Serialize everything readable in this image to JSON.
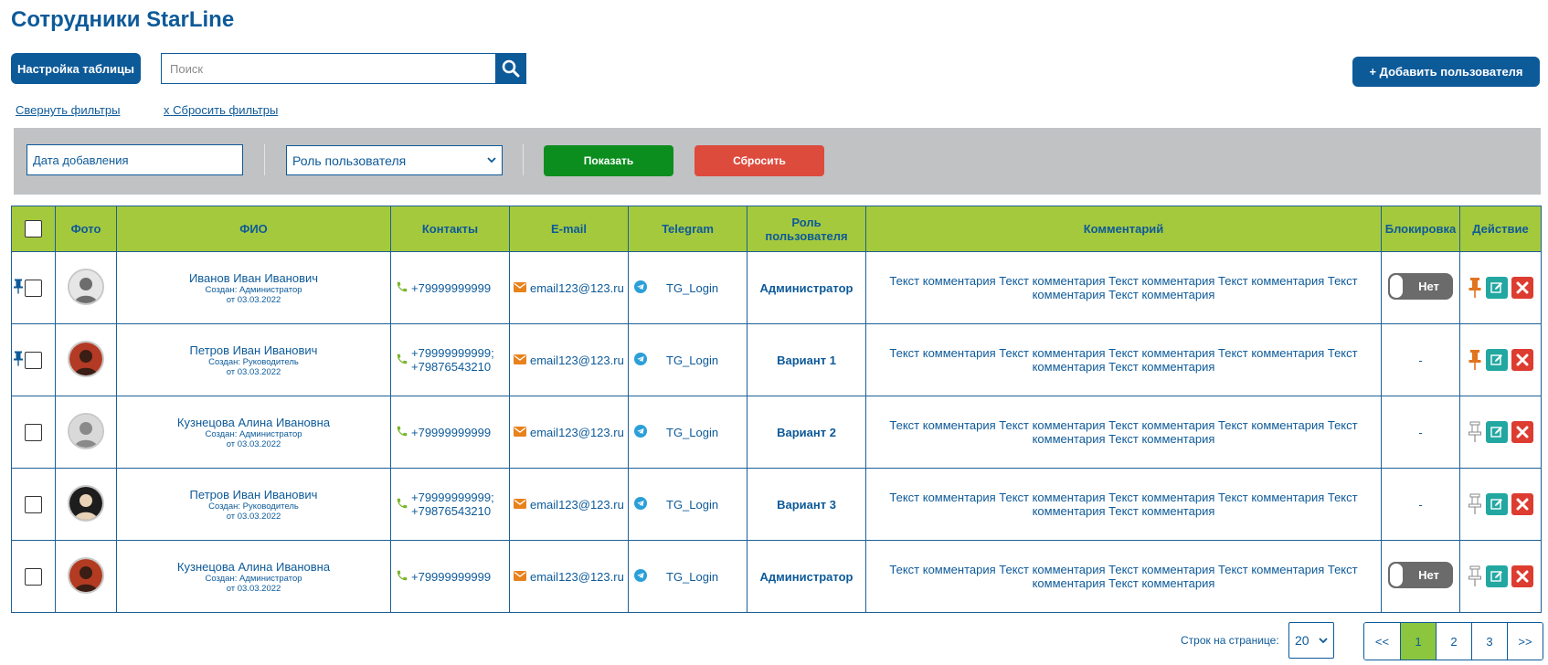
{
  "page": {
    "title": "Сотрудники StarLine"
  },
  "toolbar": {
    "settings_label": "Настройка таблицы",
    "search_placeholder": "Поиск",
    "add_user_label": "+ Добавить пользователя"
  },
  "filters": {
    "collapse_label": "Свернуть фильтры",
    "reset_label": "х Сбросить фильтры",
    "date_placeholder": "Дата добавления",
    "role_select_value": "Роль пользователя",
    "show_label": "Показать",
    "reset_button_label": "Сбросить"
  },
  "table": {
    "headers": {
      "photo": "Фото",
      "fio": "ФИО",
      "contacts": "Контакты",
      "email": "E-mail",
      "telegram": "Telegram",
      "role_line1": "Роль",
      "role_line2": "пользователя",
      "comment": "Комментарий",
      "block": "Блокировка",
      "action": "Действие"
    },
    "rows": [
      {
        "pinned": true,
        "name": "Иванов Иван Иванович",
        "created": "Создан: Администратор",
        "date": "от 03.03.2022",
        "phone1": "+79999999999",
        "phone2": "",
        "email": "email123@123.ru",
        "telegram": "TG_Login",
        "role": "Администратор",
        "comment": "Текст комментария Текст комментария Текст комментария Текст комментария Текст комментария Текст комментария",
        "block": "Нет",
        "pin_active": true
      },
      {
        "pinned": true,
        "name": "Петров Иван Иванович",
        "created": "Создан: Руководитель",
        "date": "от 03.03.2022",
        "phone1": "+79999999999;",
        "phone2": "+79876543210",
        "email": "email123@123.ru",
        "telegram": "TG_Login",
        "role": "Вариант 1",
        "comment": "Текст комментария Текст комментария Текст комментария Текст комментария Текст комментария Текст комментария",
        "block": "-",
        "pin_active": true
      },
      {
        "pinned": false,
        "name": "Кузнецова Алина Ивановна",
        "created": "Создан: Администратор",
        "date": "от 03.03.2022",
        "phone1": "+79999999999",
        "phone2": "",
        "email": "email123@123.ru",
        "telegram": "TG_Login",
        "role": "Вариант 2",
        "comment": "Текст комментария Текст комментария Текст комментария Текст комментария Текст комментария Текст комментария",
        "block": "-",
        "pin_active": false
      },
      {
        "pinned": false,
        "name": "Петров Иван Иванович",
        "created": "Создан: Руководитель",
        "date": "от 03.03.2022",
        "phone1": "+79999999999;",
        "phone2": "+79876543210",
        "email": "email123@123.ru",
        "telegram": "TG_Login",
        "role": "Вариант 3",
        "comment": "Текст комментария Текст комментария Текст комментария Текст комментария Текст комментария Текст комментария",
        "block": "-",
        "pin_active": false
      },
      {
        "pinned": false,
        "name": "Кузнецова Алина Ивановна",
        "created": "Создан: Администратор",
        "date": "от 03.03.2022",
        "phone1": "+79999999999",
        "phone2": "",
        "email": "email123@123.ru",
        "telegram": "TG_Login",
        "role": "Администратор",
        "comment": "Текст комментария Текст комментария Текст комментария Текст комментария Текст комментария Текст комментария",
        "block": "Нет",
        "pin_active": false
      }
    ]
  },
  "pagination": {
    "rows_label": "Строк на странице:",
    "rows_value": "20",
    "pages": [
      "<<",
      "1",
      "2",
      "3",
      ">>"
    ],
    "active_page": "1"
  },
  "icons": {
    "search": "search-icon",
    "phone": "phone-icon",
    "email": "envelope-icon",
    "telegram": "telegram-icon",
    "pin": "pin-icon",
    "edit": "edit-icon",
    "delete": "close-icon",
    "chevron": "chevron-down-icon"
  },
  "colors": {
    "primary": "#0d5a99",
    "header_green": "#a5c93d",
    "show_green": "#0b8e1e",
    "reset_red": "#dd4b3d",
    "edit_teal": "#22a7a1",
    "delete_red": "#dd3c31",
    "pin_orange": "#e2731f",
    "phone_green": "#7ab62e",
    "email_orange": "#e8821c",
    "telegram_blue": "#2a9fd8",
    "toggle_gray": "#6b6b6b",
    "filter_bg": "#c1c2c4",
    "page_active": "#8cc63e"
  }
}
